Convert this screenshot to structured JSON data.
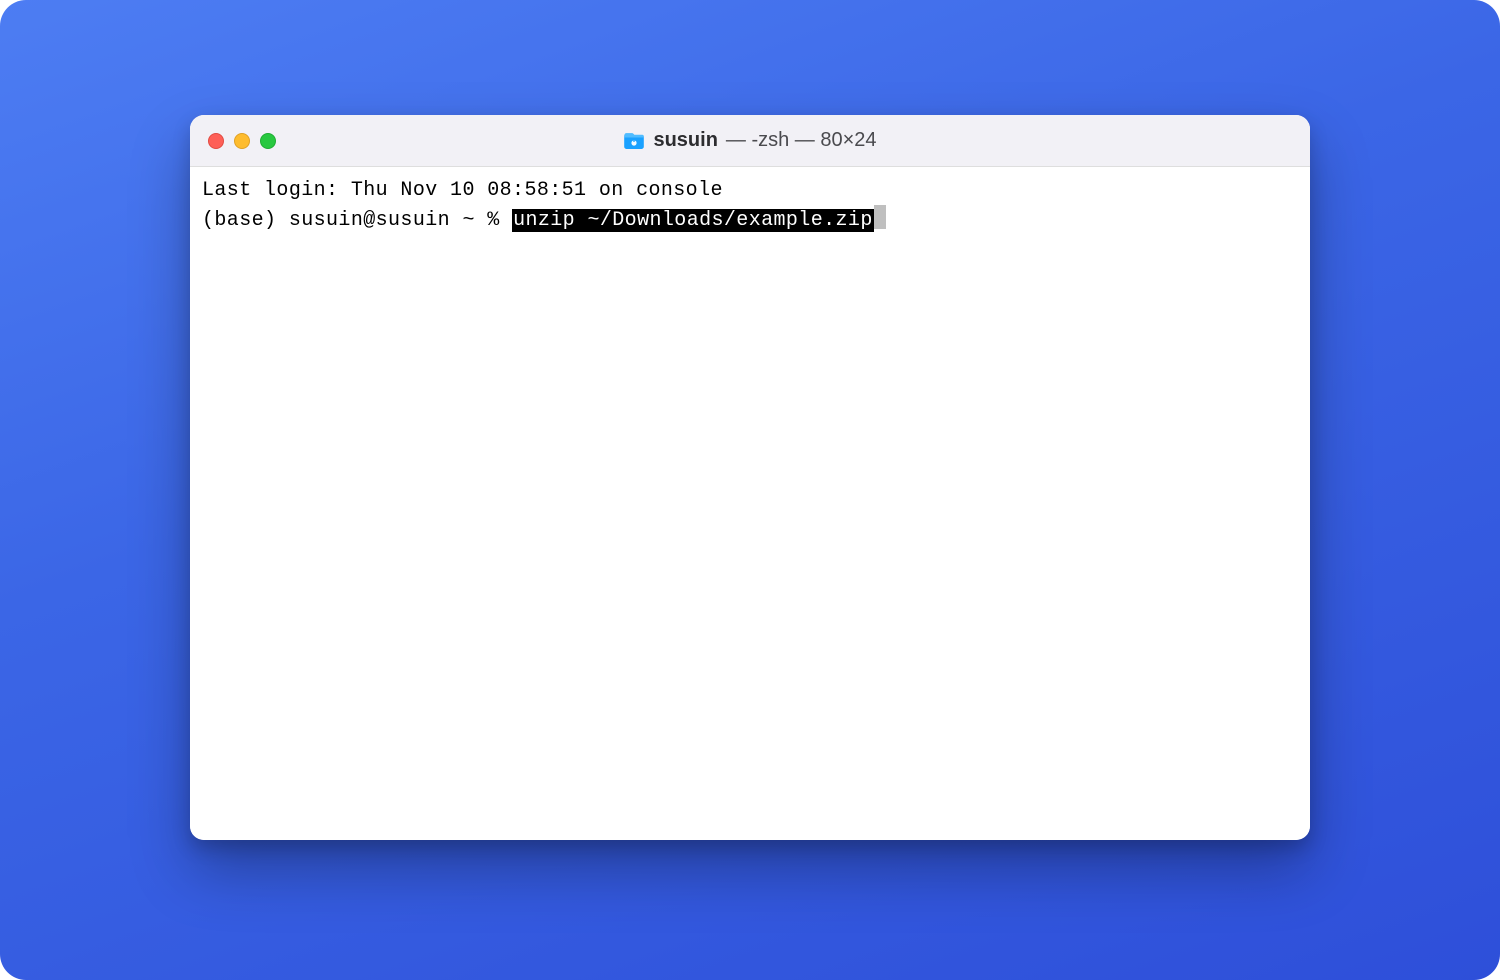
{
  "window": {
    "title_primary": "susuin",
    "title_rest": " — -zsh — 80×24",
    "traffic_lights": {
      "close": "close",
      "minimize": "minimize",
      "zoom": "zoom"
    },
    "folder_icon_color": "#1aa1ff"
  },
  "terminal": {
    "line1": "Last login: Thu Nov 10 08:58:51 on console",
    "prompt": "(base) susuin@susuin ~ % ",
    "selected_command": "unzip ~/Downloads/example.zip"
  }
}
